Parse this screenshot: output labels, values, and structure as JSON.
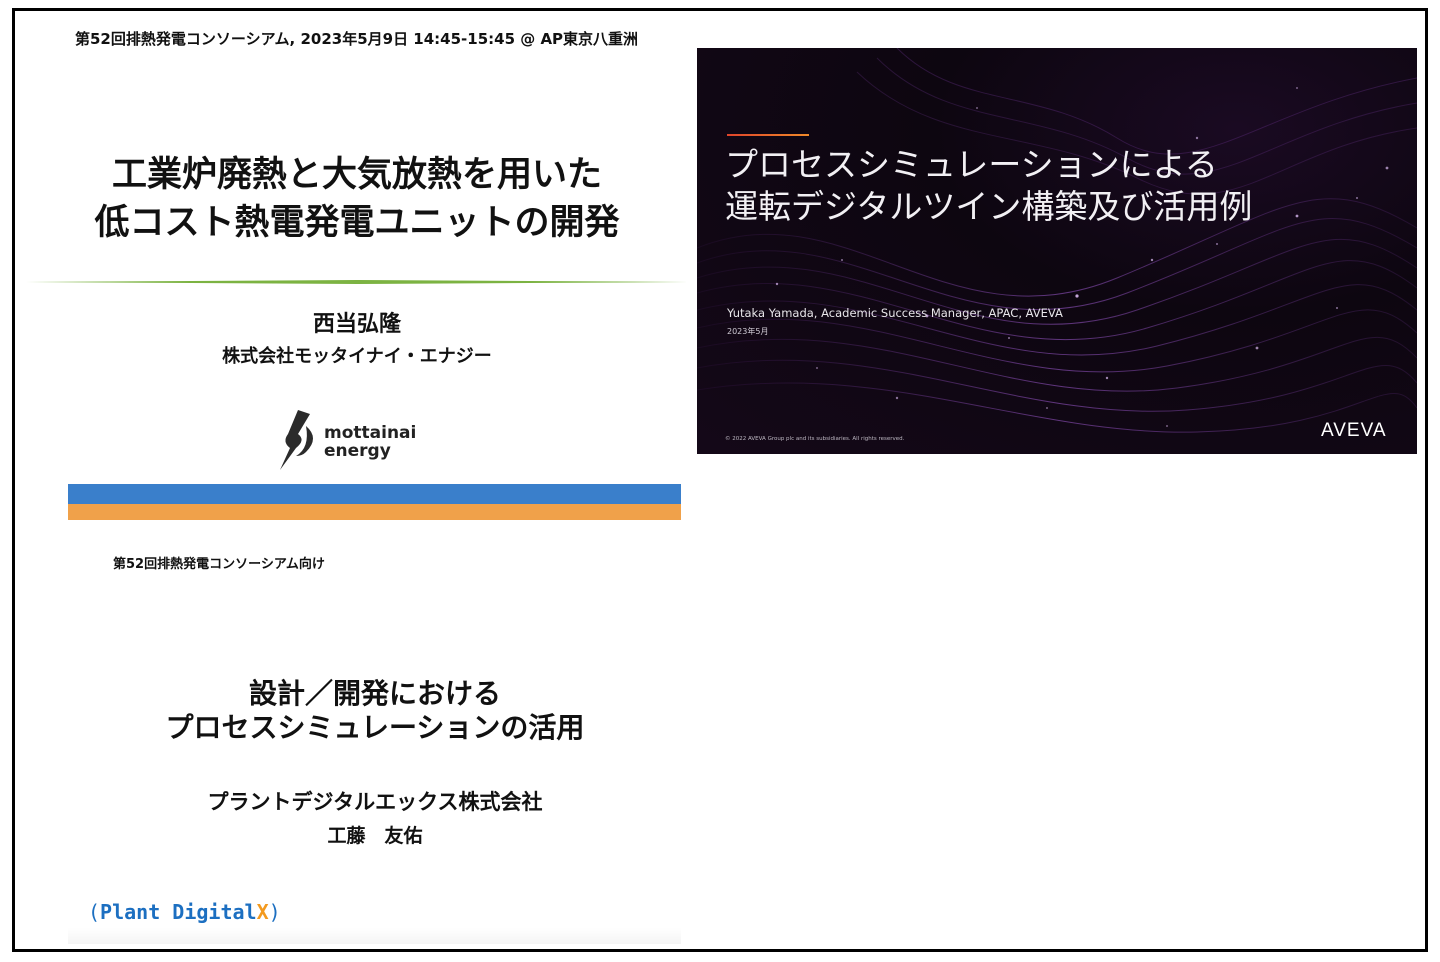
{
  "slide1": {
    "header": "第52回排熱発電コンソーシアム, 2023年5月9日 14:45-15:45 @ AP東京八重洲",
    "title_line1": "工業炉廃熱と大気放熱を用いた",
    "title_line2": "低コスト熱電発電ユニットの開発",
    "author": "西当弘隆",
    "company": "株式会社モッタイナイ・エナジー",
    "logo_line1": "mottainai",
    "logo_line2": "energy",
    "colors": {
      "rule": "#7cb342",
      "bar_blue": "#3a7fcb",
      "bar_orange": "#f0a14a"
    }
  },
  "slide2": {
    "title_line1": "プロセスシミュレーションによる",
    "title_line2": "運転デジタルツイン構築及び活用例",
    "byline": "Yutaka Yamada, Academic Success Manager, APAC, AVEVA",
    "date": "2023年5月",
    "copyright": "© 2022 AVEVA Group plc and its subsidiaries. All rights reserved.",
    "brand": "AVEVA",
    "colors": {
      "background": "#0d0610",
      "accent": "#e0452b",
      "particles": "#a25cd6"
    }
  },
  "slide3": {
    "header": "第52回排熱発電コンソーシアム向け",
    "title_line1": "設計／開発における",
    "title_line2": "プロセスシミュレーションの活用",
    "company": "プラントデジタルエックス株式会社",
    "person": "工藤　友佑",
    "logo_open": "(",
    "logo_text": "Plant Digital",
    "logo_x": "X",
    "logo_close": ")",
    "colors": {
      "logo_blue": "#1c6fc1",
      "logo_orange": "#f39a1f"
    }
  }
}
